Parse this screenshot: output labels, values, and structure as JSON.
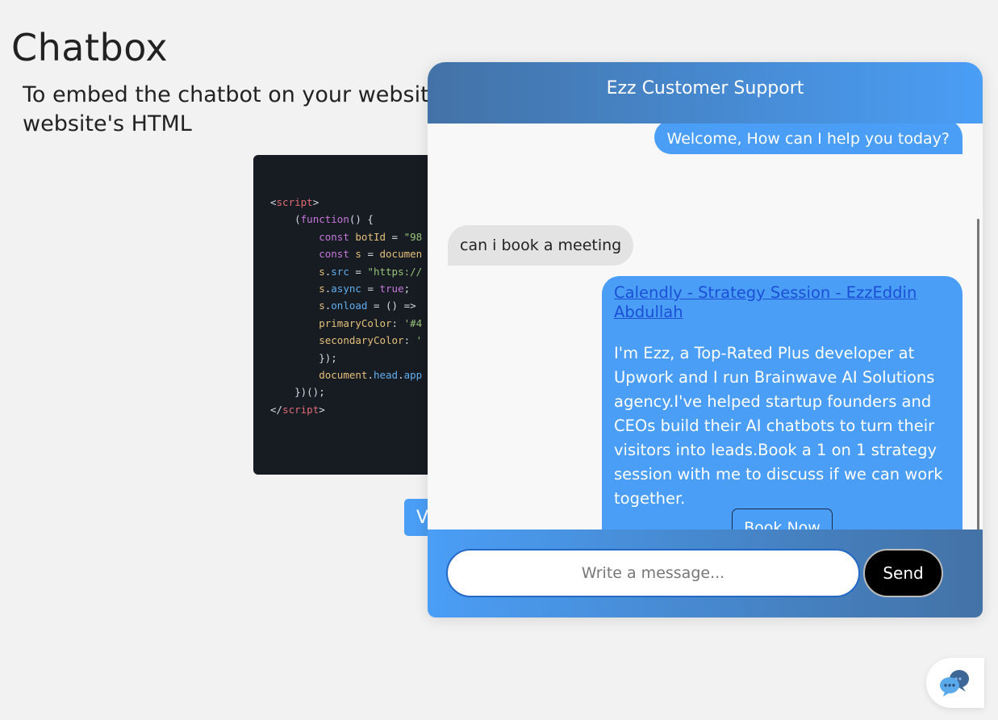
{
  "page": {
    "title": "Chatbox",
    "instructions_line1": "To embed the chatbot on your websit",
    "instructions_line2": "website's HTML",
    "button_label": "V"
  },
  "code": {
    "lines": [
      [
        [
          "c-plain",
          "<"
        ],
        [
          "c-tag",
          "script"
        ],
        [
          "c-plain",
          ">"
        ]
      ],
      [
        [
          "c-plain",
          "    ("
        ],
        [
          "c-kw",
          "function"
        ],
        [
          "c-plain",
          "() {"
        ]
      ],
      [
        [
          "c-plain",
          "        "
        ],
        [
          "c-kw",
          "const"
        ],
        [
          "c-plain",
          " "
        ],
        [
          "c-var",
          "botId"
        ],
        [
          "c-plain",
          " = "
        ],
        [
          "c-str",
          "\"98"
        ]
      ],
      [
        [
          "c-plain",
          "        "
        ],
        [
          "c-kw",
          "const"
        ],
        [
          "c-plain",
          " "
        ],
        [
          "c-var",
          "s"
        ],
        [
          "c-plain",
          " = "
        ],
        [
          "c-var",
          "documen"
        ]
      ],
      [
        [
          "c-plain",
          "        "
        ],
        [
          "c-var",
          "s"
        ],
        [
          "c-plain",
          "."
        ],
        [
          "c-prop",
          "src"
        ],
        [
          "c-plain",
          " = "
        ],
        [
          "c-str",
          "\"https://"
        ]
      ],
      [
        [
          "c-plain",
          "        "
        ],
        [
          "c-var",
          "s"
        ],
        [
          "c-plain",
          "."
        ],
        [
          "c-prop",
          "async"
        ],
        [
          "c-plain",
          " = "
        ],
        [
          "c-bool",
          "true"
        ],
        [
          "c-plain",
          ";"
        ]
      ],
      [
        [
          "c-plain",
          "        "
        ],
        [
          "c-var",
          "s"
        ],
        [
          "c-plain",
          "."
        ],
        [
          "c-prop",
          "onload"
        ],
        [
          "c-plain",
          " = () =>"
        ]
      ],
      [
        [
          "c-plain",
          "        "
        ],
        [
          "c-var",
          "primaryColor"
        ],
        [
          "c-plain",
          ": "
        ],
        [
          "c-str",
          "'#4"
        ]
      ],
      [
        [
          "c-plain",
          "        "
        ],
        [
          "c-var",
          "secondaryColor"
        ],
        [
          "c-plain",
          ": "
        ],
        [
          "c-str",
          "'"
        ]
      ],
      [
        [
          "c-plain",
          "        });"
        ]
      ],
      [
        [
          "c-plain",
          "        "
        ],
        [
          "c-var",
          "document"
        ],
        [
          "c-plain",
          "."
        ],
        [
          "c-prop",
          "head"
        ],
        [
          "c-plain",
          "."
        ],
        [
          "c-prop",
          "app"
        ]
      ],
      [
        [
          "c-plain",
          "    })();"
        ]
      ],
      [
        [
          "c-plain",
          "</"
        ],
        [
          "c-tag",
          "script"
        ],
        [
          "c-plain",
          ">"
        ]
      ]
    ]
  },
  "chat": {
    "header_title": "Ezz Customer Support",
    "messages": {
      "welcome": "Welcome, How can I help you today?",
      "user": "can i book a meeting",
      "calendly_link": "Calendly - Strategy Session - EzzEddin Abdullah",
      "calendly_description": "I'm Ezz, a Top-Rated Plus developer at Upwork and I run Brainwave AI Solutions agency.I've helped startup founders and CEOs build their AI chatbots to turn their visitors into leads.Book a 1 on 1 strategy session with me to discuss if we can work together.",
      "book_now_label": "Book Now"
    },
    "input_placeholder": "Write a message...",
    "send_label": "Send"
  },
  "colors": {
    "primary": "#4a9ef6",
    "secondary": "#4372a6",
    "code_bg": "#171b22"
  },
  "launcher": {
    "icon": "chat-bubbles-icon"
  }
}
